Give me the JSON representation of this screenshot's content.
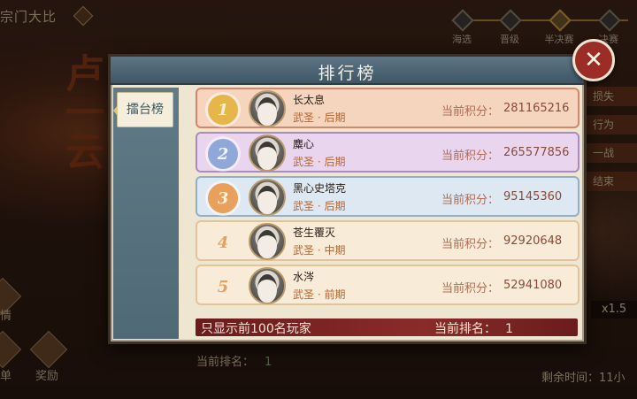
{
  "background": {
    "title": "宗门大比",
    "calligraphy": "卢一云",
    "stages": [
      {
        "label": "海选"
      },
      {
        "label": "晋级"
      },
      {
        "label": "半决赛"
      },
      {
        "label": "决赛"
      }
    ],
    "left_buttons": [
      {
        "label": "情"
      },
      {
        "label": "单"
      },
      {
        "label": "奖励"
      }
    ],
    "right_items": [
      "损失",
      "行为",
      "一战",
      "结束"
    ],
    "zoom": "x1.5",
    "bottom_rank_label": "当前排名：",
    "bottom_rank_value": "1",
    "remaining_time": "剩余时间：11小"
  },
  "modal": {
    "title": "排行榜",
    "tabs": [
      {
        "label": "擂台榜",
        "selected": true
      }
    ],
    "score_label": "当前积分：",
    "rows": [
      {
        "rank": "1",
        "name": "长太息",
        "realm": "武圣 · 后期",
        "score": "281165216",
        "bg": "#f6d5bf",
        "border": "#d9836a",
        "badge": "#e6b64a",
        "badge_text": "#fff4cf"
      },
      {
        "rank": "2",
        "name": "麋心",
        "realm": "武圣 · 后期",
        "score": "265577856",
        "bg": "#e9d6ee",
        "border": "#a98bc2",
        "badge": "#8fa8d8",
        "badge_text": "#f0f4ff"
      },
      {
        "rank": "3",
        "name": "黑心史塔克",
        "realm": "武圣 · 后期",
        "score": "95145360",
        "bg": "#dde8f2",
        "border": "#8fb0c8",
        "badge": "#e9a05c",
        "badge_text": "#fff2de"
      },
      {
        "rank": "4",
        "name": "苍生覆灭",
        "realm": "武圣 · 中期",
        "score": "92920648",
        "bg": "#f8ecd8",
        "border": "#e2c39a",
        "badge": "transparent",
        "badge_text": "#e3a35e"
      },
      {
        "rank": "5",
        "name": "水涔",
        "realm": "武圣 · 前期",
        "score": "52941080",
        "bg": "#f8ecd8",
        "border": "#e2c39a",
        "badge": "transparent",
        "badge_text": "#e3a35e"
      }
    ],
    "footer": {
      "note": "只显示前100名玩家",
      "rank_label": "当前排名：",
      "rank_value": "1"
    }
  }
}
